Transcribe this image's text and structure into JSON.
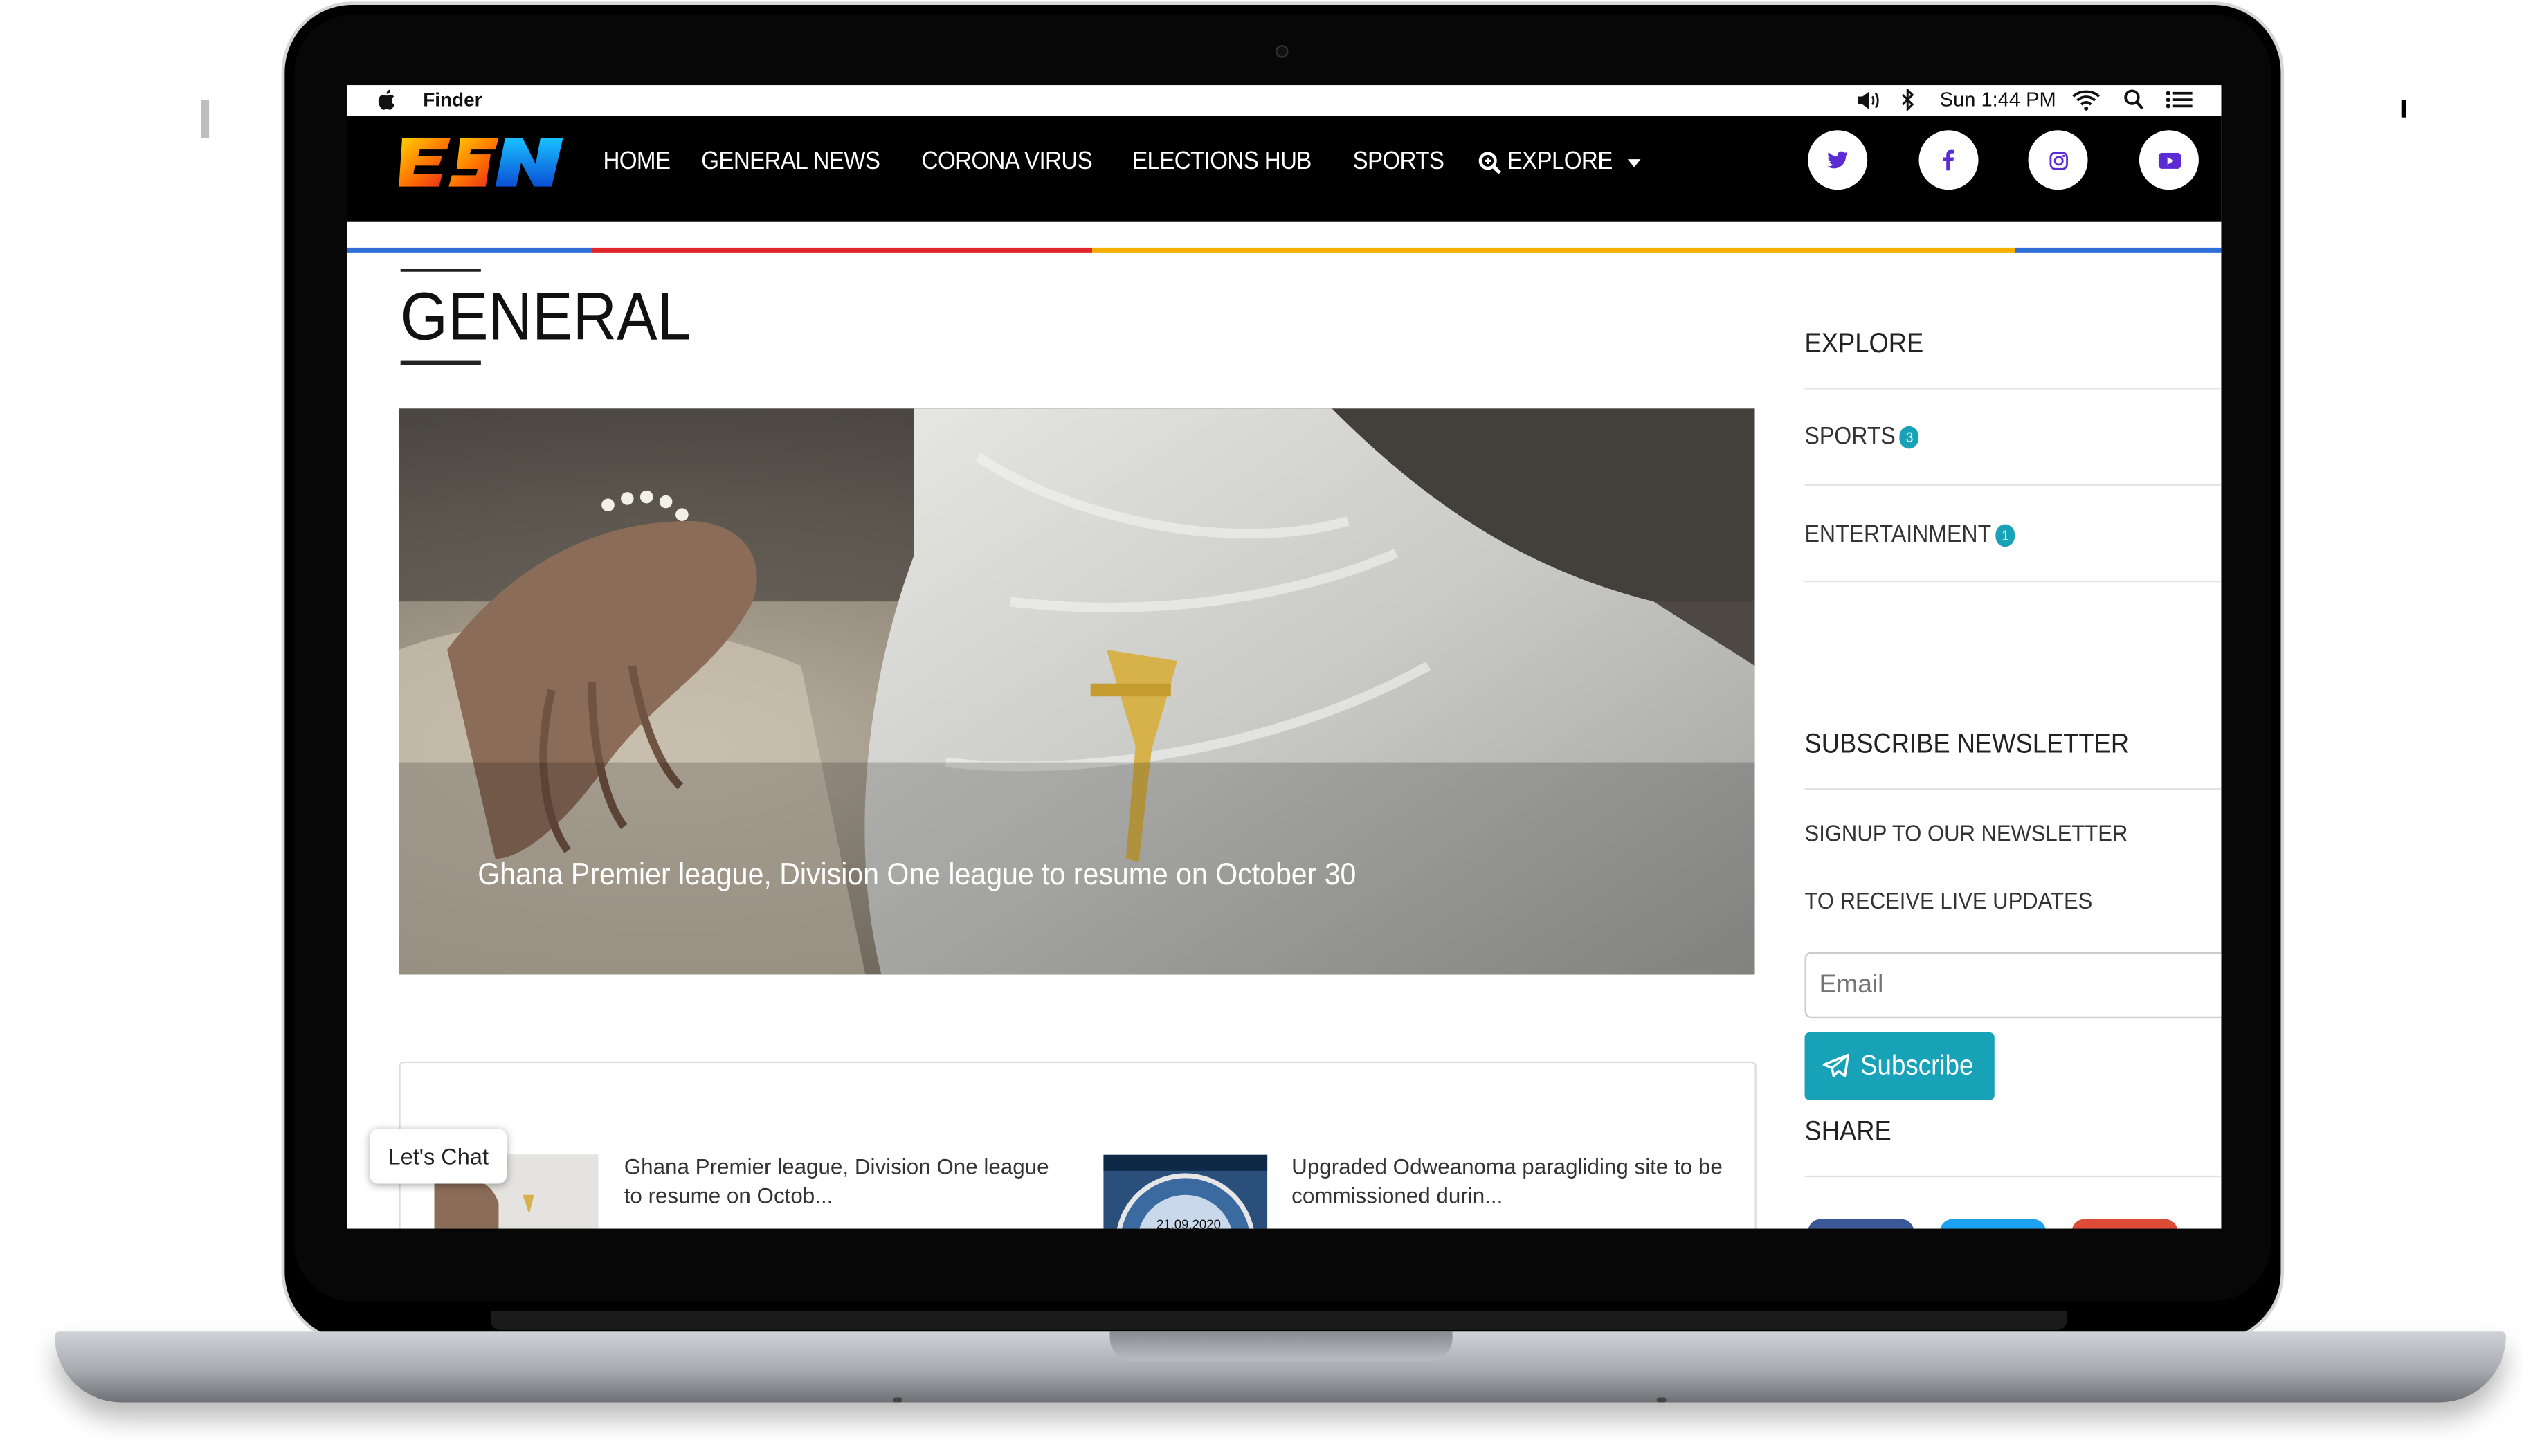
{
  "menubar": {
    "app": "Finder",
    "clock": "Sun 1:44 PM"
  },
  "nav": {
    "logo_text": "ESN",
    "links": [
      {
        "label": "HOME"
      },
      {
        "label": "GENERAL NEWS"
      },
      {
        "label": "CORONA VIRUS"
      },
      {
        "label": "ELECTIONS HUB"
      },
      {
        "label": "SPORTS"
      },
      {
        "label": "EXPLORE"
      }
    ],
    "social": [
      "twitter-icon",
      "facebook-icon",
      "instagram-icon",
      "youtube-icon"
    ],
    "stripe_colors": [
      "#2f6fd6",
      "#e1262b",
      "#f4b000",
      "#2f6fd6"
    ]
  },
  "main": {
    "page_title": "GENERAL",
    "hero_caption": "Ghana Premier league, Division One league to resume on October 30",
    "news": [
      {
        "title": "Ghana Premier league, Division One league to resume on Octob..."
      },
      {
        "title": "Upgraded Odweanoma paragliding site to be commissioned durin...",
        "thumb_text": "21.09.2020"
      }
    ]
  },
  "sidebar": {
    "explore_title": "EXPLORE",
    "categories": [
      {
        "label": "SPORTS",
        "count": "3"
      },
      {
        "label": "ENTERTAINMENT",
        "count": "1"
      }
    ],
    "newsletter_title": "SUBSCRIBE NEWSLETTER",
    "newsletter_line1": "SIGNUP TO OUR NEWSLETTER",
    "newsletter_line2": "TO RECEIVE LIVE UPDATES",
    "email_placeholder": "Email",
    "subscribe_label": "Subscribe",
    "share_title": "SHARE",
    "accent_color": "#17a2b8"
  },
  "chat": {
    "label": "Let's Chat"
  }
}
